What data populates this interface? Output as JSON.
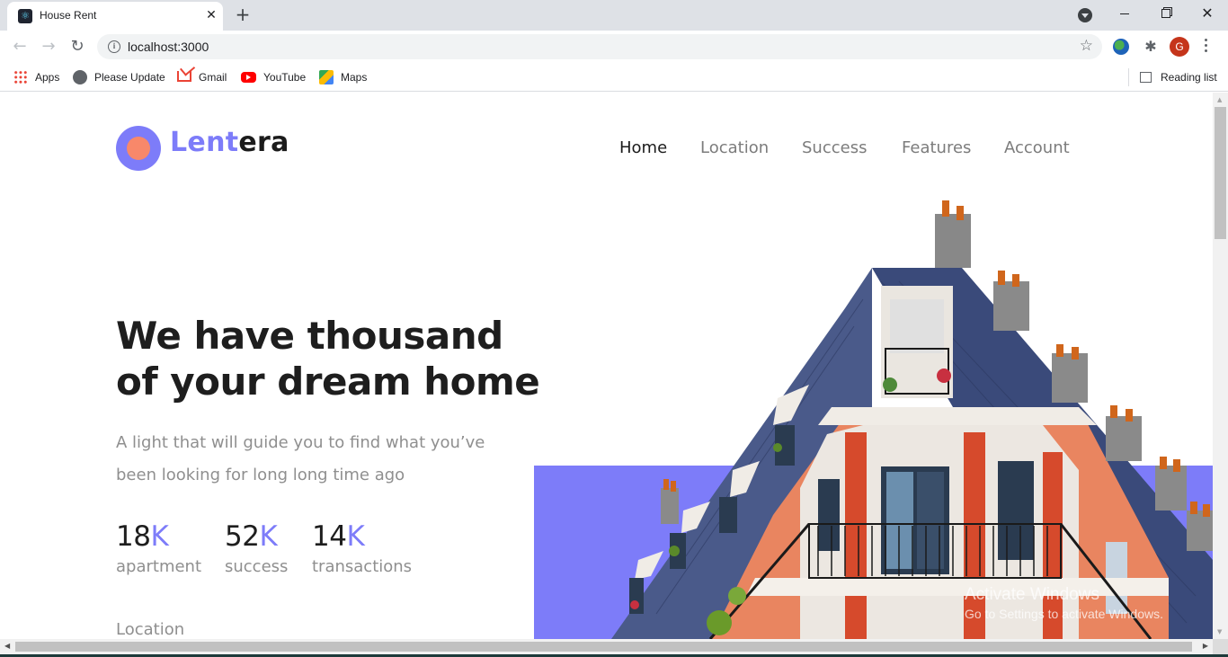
{
  "browser": {
    "tab_title": "House Rent",
    "url": "localhost:3000",
    "profile_initial": "G",
    "bookmarks": [
      "Apps",
      "Please Update",
      "Gmail",
      "YouTube",
      "Maps"
    ],
    "reading_list": "Reading list"
  },
  "site": {
    "logo_part1": "Lent",
    "logo_part2": "era",
    "nav": [
      "Home",
      "Location",
      "Success",
      "Features",
      "Account"
    ],
    "active_nav": "Home",
    "accent_color": "#7d7cf9",
    "logo_inner_color": "#f8886a",
    "hero": {
      "title": "We have thousand of your dream home",
      "subtitle": "A light that will guide you to find what you’ve been looking for long long time ago"
    },
    "stats": [
      {
        "value": "18",
        "suffix": "K",
        "label": "apartment"
      },
      {
        "value": "52",
        "suffix": "K",
        "label": "success"
      },
      {
        "value": "14",
        "suffix": "K",
        "label": "transactions"
      }
    ],
    "next_section_label": "Location"
  },
  "os": {
    "watermark_title": "Activate Windows",
    "watermark_sub": "Go to Settings to activate Windows."
  }
}
